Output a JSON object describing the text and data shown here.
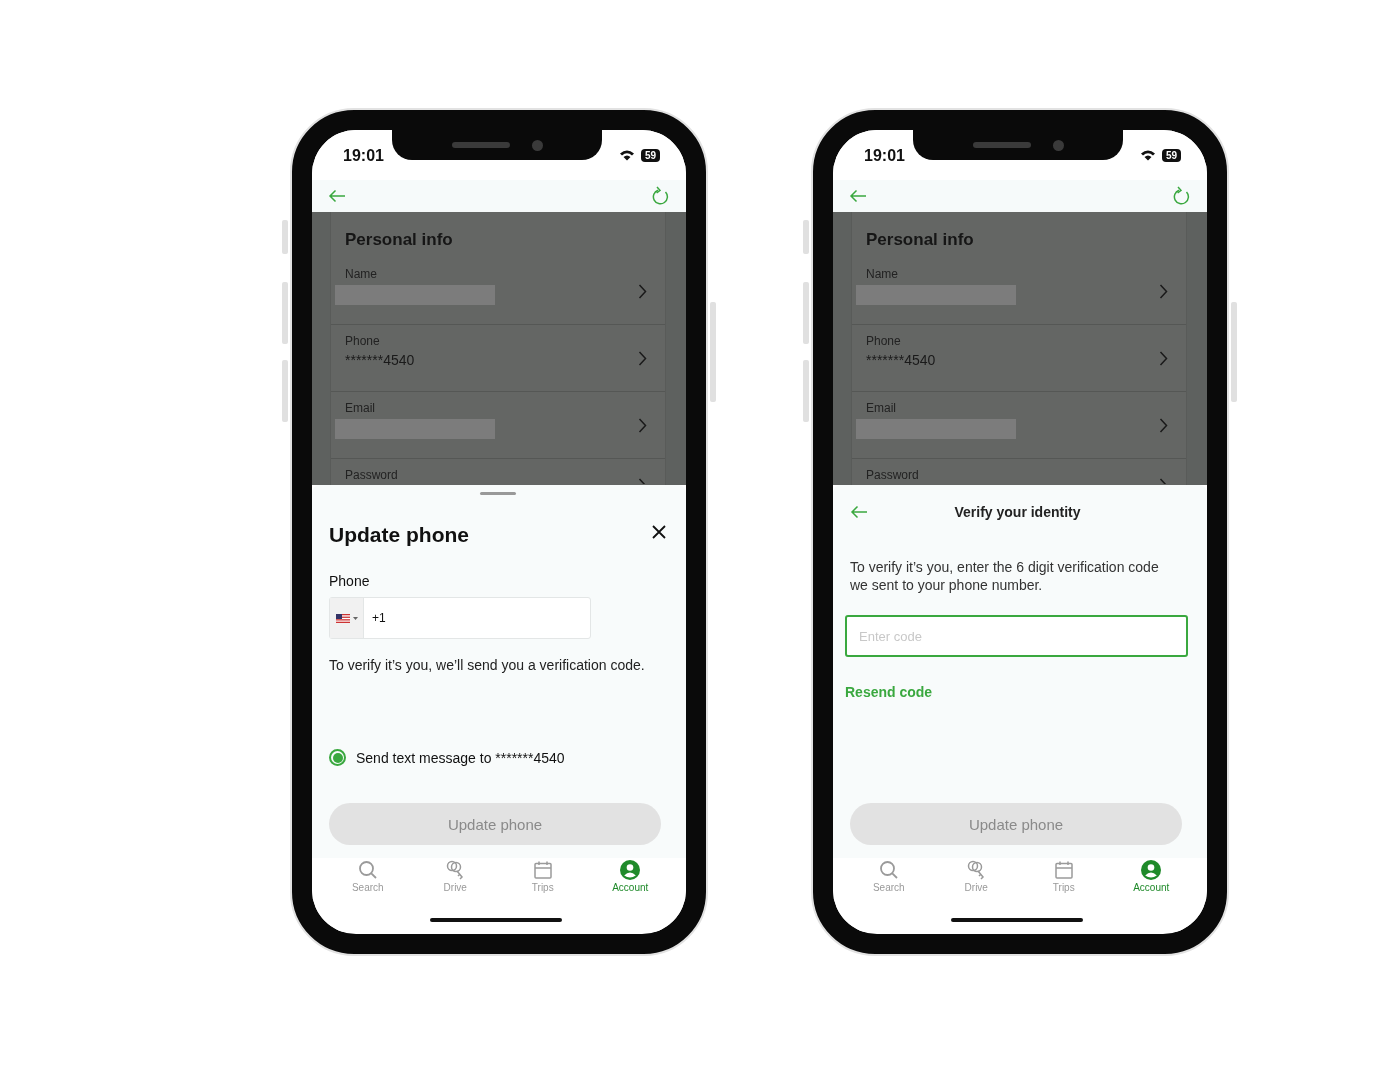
{
  "phones": [
    {
      "status": {
        "time": "19:01",
        "battery": "59"
      },
      "background": {
        "title": "Personal info",
        "rows": [
          {
            "label": "Name",
            "redacted": true
          },
          {
            "label": "Phone",
            "value": "*******4540",
            "redacted": false
          },
          {
            "label": "Email",
            "redacted": true
          },
          {
            "label": "Password",
            "redacted": false
          }
        ]
      },
      "sheet": {
        "kind": "update_phone",
        "title": "Update phone",
        "field_label": "Phone",
        "dial_code": "+1",
        "note": "To verify it’s you, we’ll send you a verification code.",
        "option": {
          "label": "Send text message to *******4540",
          "selected": true
        },
        "button": {
          "label": "Update phone",
          "disabled": true
        }
      },
      "tab_bar": [
        {
          "label": "Search",
          "selected": false
        },
        {
          "label": "Drive",
          "selected": false
        },
        {
          "label": "Trips",
          "selected": false
        },
        {
          "label": "Account",
          "selected": true
        }
      ]
    },
    {
      "status": {
        "time": "19:01",
        "battery": "59"
      },
      "background": {
        "title": "Personal info",
        "rows": [
          {
            "label": "Name",
            "redacted": true
          },
          {
            "label": "Phone",
            "value": "*******4540",
            "redacted": false
          },
          {
            "label": "Email",
            "redacted": true
          },
          {
            "label": "Password",
            "redacted": false
          }
        ]
      },
      "sheet": {
        "kind": "verify",
        "title": "Verify your identity",
        "note": "To verify it’s you, enter the 6 digit verification code we sent to your phone number.",
        "placeholder": "Enter code",
        "link": "Resend code",
        "button": {
          "label": "Update phone",
          "disabled": true
        }
      },
      "tab_bar": [
        {
          "label": "Search",
          "selected": false
        },
        {
          "label": "Drive",
          "selected": false
        },
        {
          "label": "Trips",
          "selected": false
        },
        {
          "label": "Account",
          "selected": true
        }
      ]
    }
  ]
}
